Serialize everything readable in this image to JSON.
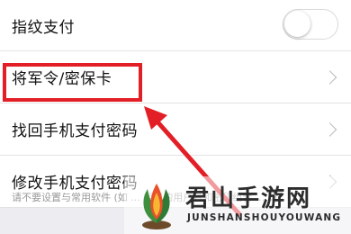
{
  "settings": {
    "items": [
      {
        "label": "指纹支付",
        "control": "toggle",
        "toggle_on": false
      },
      {
        "label": "将军令/密保卡",
        "control": "chevron"
      },
      {
        "label": "找回手机支付密码",
        "control": "chevron"
      },
      {
        "label": "修改手机支付密码",
        "control": "chevron"
      }
    ],
    "footnote": "请不要设置与常用软件 (如 ... 相似的用户名和密码组合 ... 改"
  },
  "annotation": {
    "highlight_color": "#e21f26",
    "arrow_color": "#e21f26"
  },
  "watermark": {
    "title": "君山手游网",
    "subtitle": "JUNSHANSHOUYOUWANG",
    "icon": "flame-leaf-logo-icon"
  }
}
